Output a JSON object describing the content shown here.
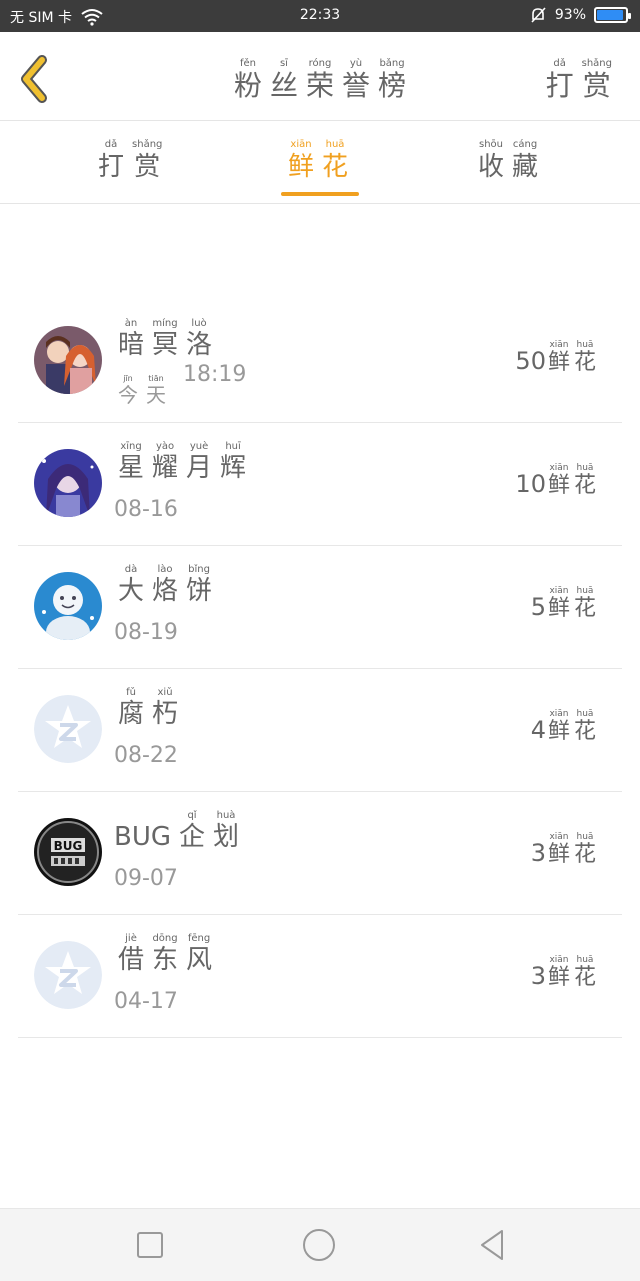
{
  "status": {
    "carrier": "无 SIM 卡",
    "time": "22:33",
    "battery": "93%",
    "battery_level": 0.93,
    "accent": "#2f8df5"
  },
  "header": {
    "title": [
      {
        "py": "fěn",
        "hz": "粉"
      },
      {
        "py": "sī",
        "hz": "丝"
      },
      {
        "py": "róng",
        "hz": "荣"
      },
      {
        "py": "yù",
        "hz": "誉"
      },
      {
        "py": "bǎng",
        "hz": "榜"
      }
    ],
    "action": [
      {
        "py": "dǎ",
        "hz": "打"
      },
      {
        "py": "shǎng",
        "hz": "赏"
      }
    ],
    "back_icon": "chevron-left-icon",
    "back_color": "#f0c030"
  },
  "tabs": [
    {
      "chars": [
        {
          "py": "dǎ",
          "hz": "打"
        },
        {
          "py": "shǎng",
          "hz": "赏"
        }
      ],
      "active": false
    },
    {
      "chars": [
        {
          "py": "xiān",
          "hz": "鲜"
        },
        {
          "py": "huā",
          "hz": "花"
        }
      ],
      "active": true
    },
    {
      "chars": [
        {
          "py": "shōu",
          "hz": "收"
        },
        {
          "py": "cáng",
          "hz": "藏"
        }
      ],
      "active": false
    }
  ],
  "accent": "#f0a020",
  "unit": [
    {
      "py": "xiān",
      "hz": "鲜"
    },
    {
      "py": "huā",
      "hz": "花"
    }
  ],
  "rows": [
    {
      "latin": "",
      "name": [
        {
          "py": "àn",
          "hz": "暗"
        },
        {
          "py": "míng",
          "hz": "冥"
        },
        {
          "py": "luò",
          "hz": "洛"
        }
      ],
      "date": "",
      "date_chars": [
        {
          "py": "jīn",
          "hz": "今"
        },
        {
          "py": "tiān",
          "hz": "天"
        }
      ],
      "time": "18:19",
      "count": "50",
      "avatar": "couple"
    },
    {
      "latin": "",
      "name": [
        {
          "py": "xīng",
          "hz": "星"
        },
        {
          "py": "yào",
          "hz": "耀"
        },
        {
          "py": "yuè",
          "hz": "月"
        },
        {
          "py": "huī",
          "hz": "辉"
        }
      ],
      "date": "08-16",
      "count": "10",
      "avatar": "anime"
    },
    {
      "latin": "",
      "name": [
        {
          "py": "dà",
          "hz": "大"
        },
        {
          "py": "lào",
          "hz": "烙"
        },
        {
          "py": "bǐng",
          "hz": "饼"
        }
      ],
      "date": "08-19",
      "count": "5",
      "avatar": "snowman"
    },
    {
      "latin": "",
      "name": [
        {
          "py": "fǔ",
          "hz": "腐"
        },
        {
          "py": "xiǔ",
          "hz": "朽"
        }
      ],
      "date": "08-22",
      "count": "4",
      "avatar": "default"
    },
    {
      "latin": "BUG",
      "name": [
        {
          "py": "qǐ",
          "hz": "企"
        },
        {
          "py": "huà",
          "hz": "划"
        }
      ],
      "date": "09-07",
      "count": "3",
      "avatar": "bug"
    },
    {
      "latin": "",
      "name": [
        {
          "py": "jiè",
          "hz": "借"
        },
        {
          "py": "dōng",
          "hz": "东"
        },
        {
          "py": "fēng",
          "hz": "风"
        }
      ],
      "date": "04-17",
      "count": "3",
      "avatar": "default"
    }
  ],
  "navbar": {
    "icons": [
      "square-icon",
      "circle-icon",
      "triangle-back-icon"
    ]
  }
}
